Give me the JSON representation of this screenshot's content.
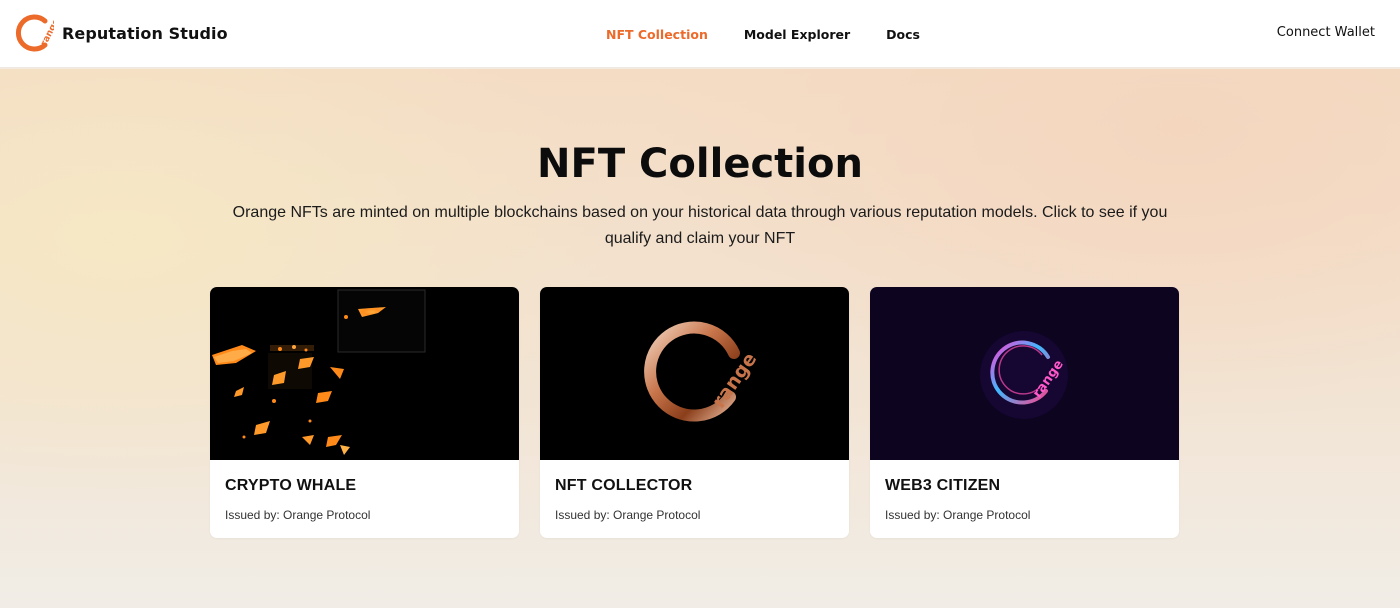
{
  "brand": {
    "logo_text": "range",
    "name": "Reputation Studio",
    "accent_color": "#ec6a2a"
  },
  "nav": {
    "links": [
      {
        "label": "NFT Collection",
        "active": true
      },
      {
        "label": "Model Explorer",
        "active": false
      },
      {
        "label": "Docs",
        "active": false
      }
    ],
    "wallet_label": "Connect Wallet"
  },
  "hero": {
    "title": "NFT Collection",
    "subtitle": "Orange NFTs are minted on multiple blockchains based on your historical data through various reputation models. Click to see if you qualify and claim your NFT"
  },
  "cards": [
    {
      "title": "CRYPTO WHALE",
      "issuer": "Issued by: Orange Protocol",
      "art": "glowing-orange-fragments"
    },
    {
      "title": "NFT COLLECTOR",
      "issuer": "Issued by: Orange Protocol",
      "art": "chrome-orange-logo",
      "art_text": "range"
    },
    {
      "title": "WEB3 CITIZEN",
      "issuer": "Issued by: Orange Protocol",
      "art": "neon-orange-logo",
      "art_text": "range"
    }
  ]
}
